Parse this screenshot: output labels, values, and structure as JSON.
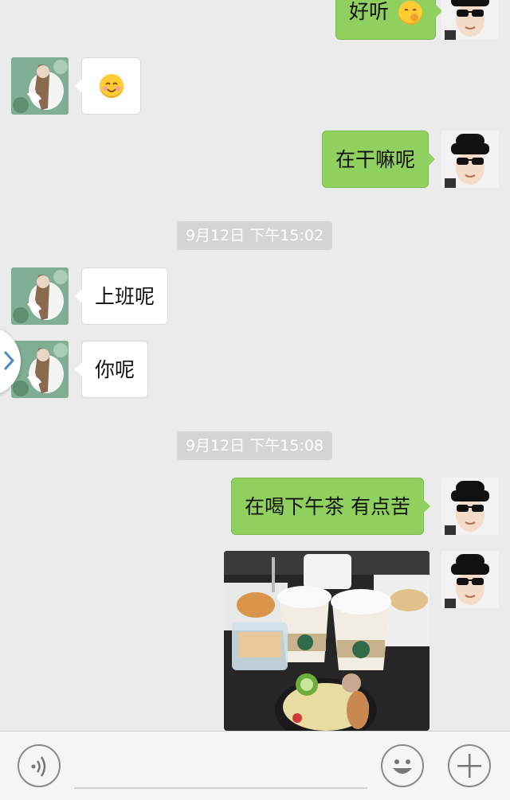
{
  "conversation": {
    "messages": [
      {
        "sender": "me",
        "text": "好听"
      },
      {
        "sender": "friend",
        "text": ""
      },
      {
        "sender": "me",
        "text": "在干嘛呢"
      },
      {
        "sender": "friend",
        "text": "上班呢"
      },
      {
        "sender": "friend",
        "text": "你呢"
      },
      {
        "sender": "me",
        "text": "在喝下午茶 有点苦"
      }
    ],
    "timestamps": [
      "9月12日 下午15:02",
      "9月12日 下午15:08"
    ]
  },
  "icons": {
    "voice": "voice-icon",
    "emoji": "emoji-icon",
    "plus": "plus-icon",
    "expand": "chevron-right-icon"
  },
  "colors": {
    "background": "#ebebeb",
    "outgoing_bubble": "#8fd05f",
    "incoming_bubble": "#ffffff",
    "timestamp_bg": "#d4d4d4"
  }
}
